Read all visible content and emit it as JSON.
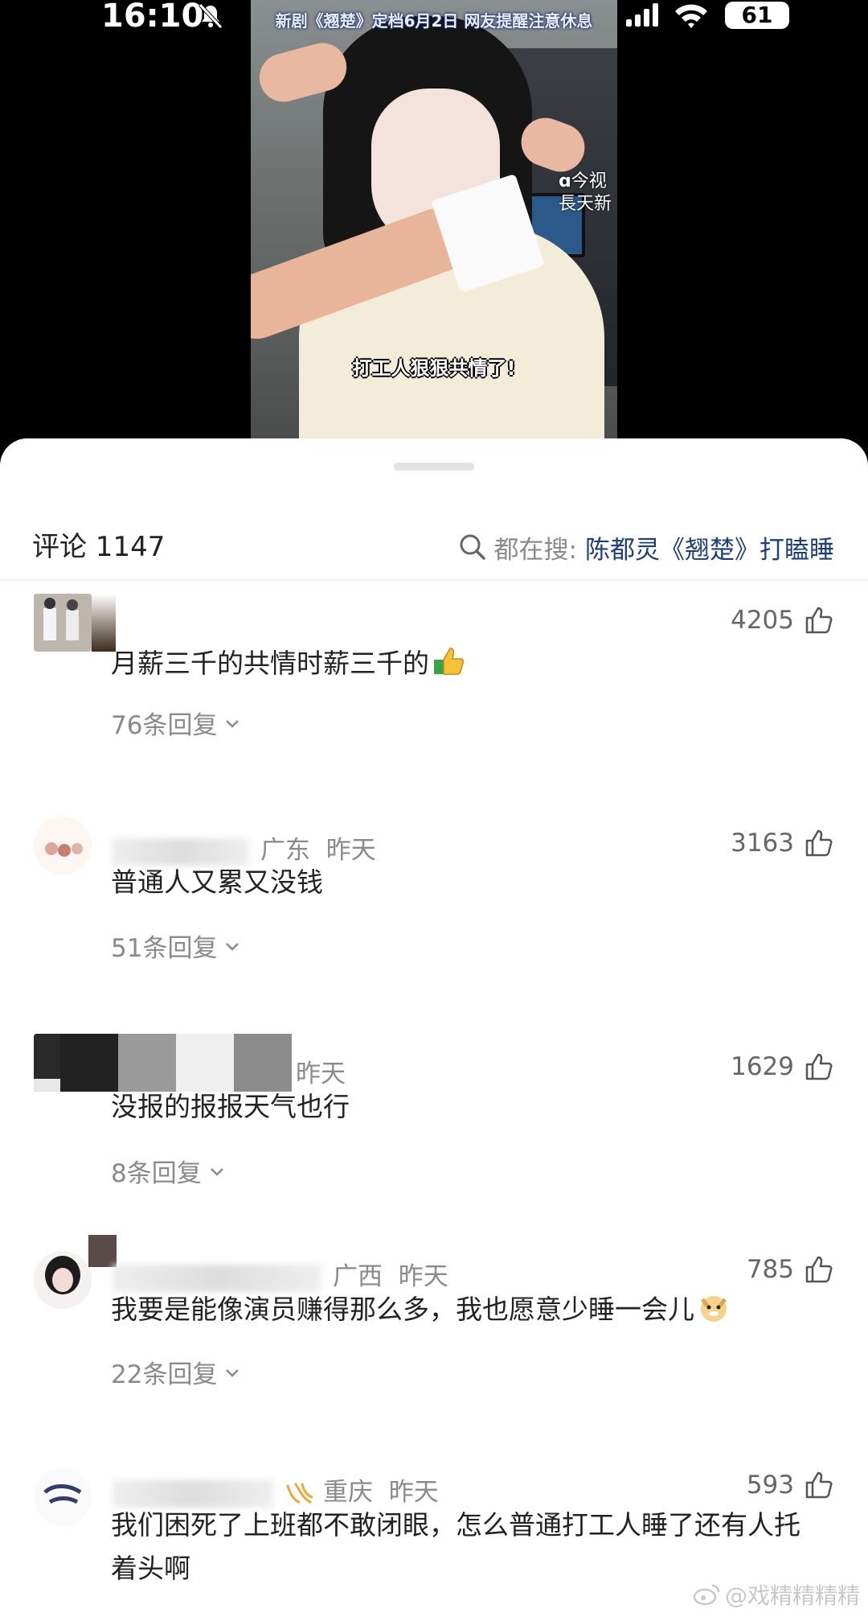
{
  "status_bar": {
    "time": "16:10",
    "battery": "61"
  },
  "video": {
    "headline": "新剧《翘楚》定档6月2日 网友提醒注意休息",
    "watermark_logo": "今视",
    "watermark_text": "長天新",
    "caption": "打工人狠狠共情了!"
  },
  "sheet": {
    "comment_count": "评论 1147",
    "hot_search_label": "都在搜:",
    "hot_search_term": "陈都灵《翘楚》打瞌睡"
  },
  "comments": [
    {
      "location": "",
      "time": "",
      "likes": "4205",
      "text": "月薪三千的共情时薪三千的",
      "replies": "76条回复"
    },
    {
      "location": "广东",
      "time": "昨天",
      "likes": "3163",
      "text": "普通人又累又没钱",
      "replies": "51条回复"
    },
    {
      "location": "",
      "time": "昨天",
      "likes": "1629",
      "text": "没报的报报天气也行",
      "replies": "8条回复"
    },
    {
      "location": "广西",
      "time": "昨天",
      "likes": "785",
      "text": "我要是能像演员赚得那么多，我也愿意少睡一会儿",
      "replies": "22条回复"
    },
    {
      "location": "重庆",
      "time": "昨天",
      "likes": "593",
      "text": "我们困死了上班都不敢闭眼，怎么普通打工人睡了还有人托着头啊",
      "replies": ""
    }
  ],
  "site_watermark": "@戏精精精精"
}
